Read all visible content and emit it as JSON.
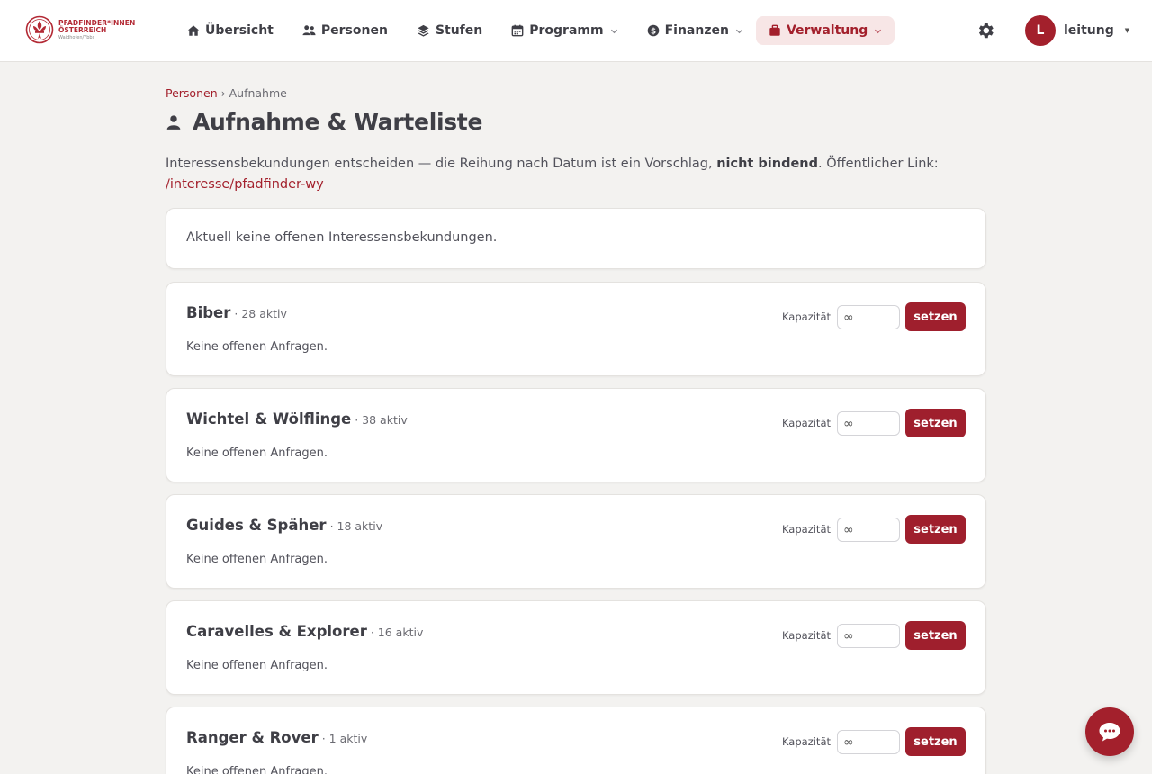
{
  "logo": {
    "line1": "PFADFINDER*INNEN",
    "line2": "ÖSTERREICH",
    "line3": "Waidhofen/Ybbs"
  },
  "nav": {
    "items": [
      {
        "label": "Übersicht",
        "icon": "home-icon"
      },
      {
        "label": "Personen",
        "icon": "people-icon"
      },
      {
        "label": "Stufen",
        "icon": "layers-icon"
      },
      {
        "label": "Programm",
        "icon": "calendar-icon",
        "dropdown": true
      },
      {
        "label": "Finanzen",
        "icon": "dollar-icon",
        "dropdown": true
      },
      {
        "label": "Verwaltung",
        "icon": "briefcase-icon",
        "dropdown": true,
        "active": true
      }
    ]
  },
  "user": {
    "initial": "L",
    "name": "leitung"
  },
  "breadcrumb": {
    "parent": "Personen",
    "separator": "›",
    "current": "Aufnahme"
  },
  "page": {
    "title": "Aufnahme & Warteliste",
    "intro_before": "Interessensbekundungen entscheiden — die Reihung nach Datum ist ein Vorschlag, ",
    "intro_bold": "nicht bindend",
    "intro_after": ". Öffentlicher Link: ",
    "intro_link": "/interesse/pfadfinder-wy"
  },
  "notice": "Aktuell keine offenen Interessensbekundungen.",
  "stufen": [
    {
      "name": "Biber",
      "count": "· 28 aktiv",
      "empty": "Keine offenen Anfragen.",
      "cap_label": "Kapazität",
      "cap_placeholder": "∞",
      "button": "setzen"
    },
    {
      "name": "Wichtel & Wölflinge",
      "count": "· 38 aktiv",
      "empty": "Keine offenen Anfragen.",
      "cap_label": "Kapazität",
      "cap_placeholder": "∞",
      "button": "setzen"
    },
    {
      "name": "Guides & Späher",
      "count": "· 18 aktiv",
      "empty": "Keine offenen Anfragen.",
      "cap_label": "Kapazität",
      "cap_placeholder": "∞",
      "button": "setzen"
    },
    {
      "name": "Caravelles & Explorer",
      "count": "· 16 aktiv",
      "empty": "Keine offenen Anfragen.",
      "cap_label": "Kapazität",
      "cap_placeholder": "∞",
      "button": "setzen"
    },
    {
      "name": "Ranger & Rover",
      "count": "· 1 aktiv",
      "empty": "Keine offenen Anfragen.",
      "cap_label": "Kapazität",
      "cap_placeholder": "∞",
      "button": "setzen"
    }
  ],
  "colors": {
    "accent": "#a3202c",
    "accent_soft": "#f7e6e6",
    "background": "#f3f2f0",
    "text": "#3f3f46"
  }
}
